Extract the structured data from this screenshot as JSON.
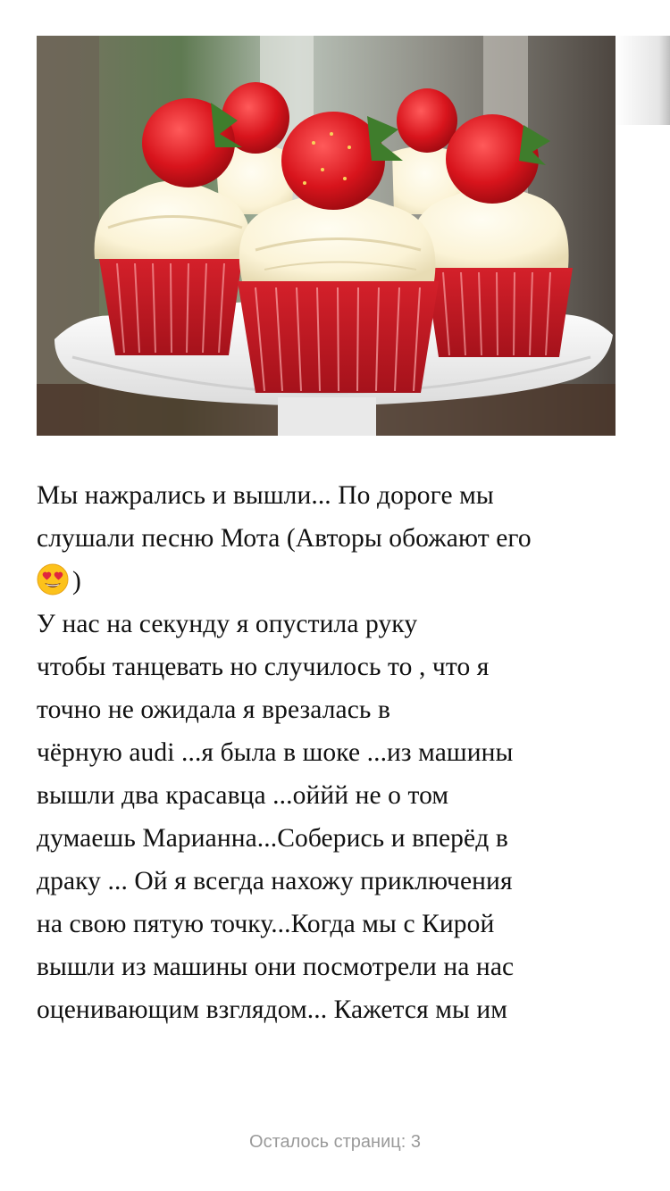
{
  "photo": {
    "icon": "strawberry-cupcakes-photo"
  },
  "story": {
    "lines": [
      "Мы нажрались и вышли... По дороге мы",
      "слушали песню Мота (Авторы обожают его",
      ")",
      "У нас на секунду я опустила руку",
      "чтобы танцевать но случилось то , что я",
      "точно не ожидала я врезалась в",
      "чёрную audi ...я была в шоке ...из машины",
      "вышли два красавца ...оййй не о том",
      "думаешь Марианна...Соберись и вперёд в",
      "драку ... Ой я всегда нахожу приключения",
      "на свою пятую точку...Когда мы с Кирой",
      "вышли из машины они посмотрели на нас",
      "оценивающим взглядом... Кажется мы им"
    ],
    "emoji": "heart-eyes-emoji"
  },
  "footer": {
    "pages_label": "Осталось страниц:",
    "pages_left": "3"
  },
  "colors": {
    "text": "#111111",
    "footer_text": "#9a9a9a",
    "background": "#ffffff"
  }
}
